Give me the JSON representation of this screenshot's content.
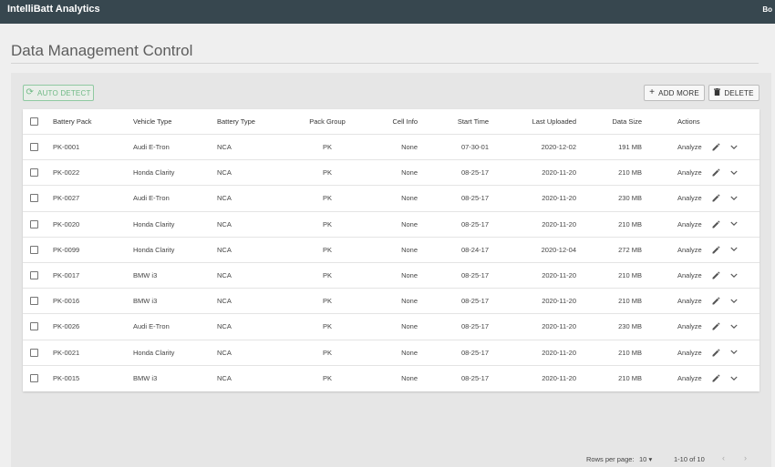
{
  "app": {
    "title": "IntelliBatt Analytics",
    "user": "Bo"
  },
  "page": {
    "title": "Data Management Control"
  },
  "toolbar": {
    "auto_detect_label": "AUTO DETECT",
    "add_more_label": "ADD MORE",
    "delete_label": "DELETE"
  },
  "table": {
    "columns": [
      "Battery Pack",
      "Vehicle Type",
      "Battery Type",
      "Pack Group",
      "Cell Info",
      "Start Time",
      "Last Uploaded",
      "Data Size",
      "Actions"
    ],
    "action_label": "Analyze",
    "rows": [
      [
        "PK-0001",
        "Audi E-Tron",
        "NCA",
        "PK",
        "None",
        "07-30-01",
        "2020-12-02",
        "191 MB"
      ],
      [
        "PK-0022",
        "Honda Clarity",
        "NCA",
        "PK",
        "None",
        "08-25-17",
        "2020-11-20",
        "210 MB"
      ],
      [
        "PK-0027",
        "Audi E-Tron",
        "NCA",
        "PK",
        "None",
        "08-25-17",
        "2020-11-20",
        "230 MB"
      ],
      [
        "PK-0020",
        "Honda Clarity",
        "NCA",
        "PK",
        "None",
        "08-25-17",
        "2020-11-20",
        "210 MB"
      ],
      [
        "PK-0099",
        "Honda Clarity",
        "NCA",
        "PK",
        "None",
        "08-24-17",
        "2020-12-04",
        "272 MB"
      ],
      [
        "PK-0017",
        "BMW i3",
        "NCA",
        "PK",
        "None",
        "08-25-17",
        "2020-11-20",
        "210 MB"
      ],
      [
        "PK-0016",
        "BMW i3",
        "NCA",
        "PK",
        "None",
        "08-25-17",
        "2020-11-20",
        "210 MB"
      ],
      [
        "PK-0026",
        "Audi E-Tron",
        "NCA",
        "PK",
        "None",
        "08-25-17",
        "2020-11-20",
        "230 MB"
      ],
      [
        "PK-0021",
        "Honda Clarity",
        "NCA",
        "PK",
        "None",
        "08-25-17",
        "2020-11-20",
        "210 MB"
      ],
      [
        "PK-0015",
        "BMW i3",
        "NCA",
        "PK",
        "None",
        "08-25-17",
        "2020-11-20",
        "210 MB"
      ]
    ]
  },
  "pagination": {
    "rows_per_page_label": "Rows per page:",
    "rows_per_page_value": "10",
    "range": "1-10 of 10"
  },
  "icons": {
    "auto_detect": "refresh-icon",
    "add": "plus-icon",
    "delete": "trash-icon",
    "edit": "pencil-icon",
    "expand": "chevron-down-icon",
    "prev": "chevron-left-icon",
    "next": "chevron-right-icon"
  },
  "colors": {
    "topbar": "#37474f",
    "auto_detect": "#6fb985"
  }
}
